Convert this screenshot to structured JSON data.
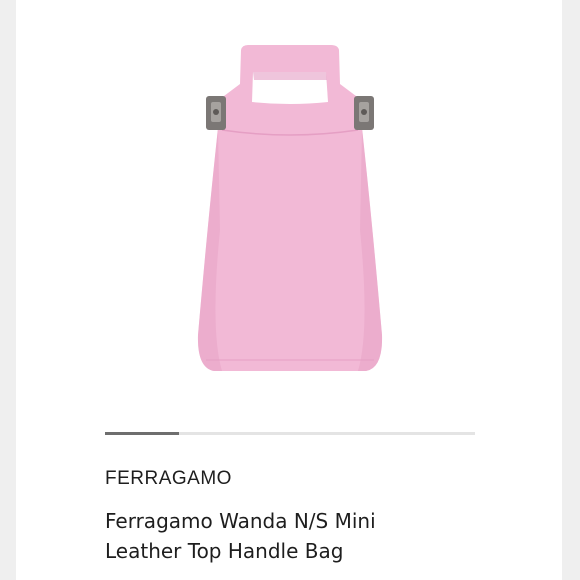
{
  "product": {
    "brand": "FERRAGAMO",
    "title_line1": "Ferragamo Wanda N/S Mini",
    "title_line2": "Leather Top Handle Bag",
    "image_icon": "pink-top-handle-bag-image"
  },
  "gallery": {
    "progress_fraction": 0.2
  },
  "colors": {
    "bag": "#f2b9d6",
    "bag_shadow": "#e59fc4",
    "hardware": "#7b7775",
    "progress_fill": "#6e6e6e",
    "progress_track": "#e4e4e4",
    "text": "#1e1e1e"
  }
}
